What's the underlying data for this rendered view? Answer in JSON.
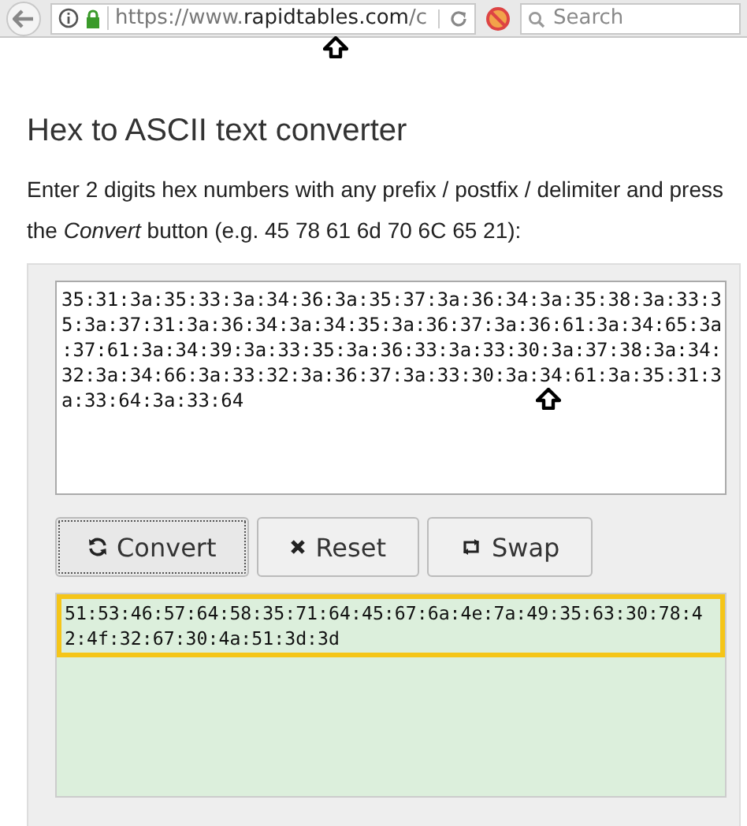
{
  "browser": {
    "url_prefix": "https://www.",
    "url_domain": "rapidtables.com",
    "url_suffix": "/c",
    "search": {
      "placeholder": "Search"
    }
  },
  "title": "Hex to ASCII text converter",
  "intro": "Enter 2 digits hex numbers with any prefix / postfix / delimiter and press the *Convert* button (e.g. 45 78 61 6d 70 6C 65 21):",
  "input": {
    "lines": [
      "35:31:3a:35:33:3a:34:36:3a:35:37:3a:36:34:3a:35:38:3a:33:3",
      "5:3a:37:31:3a:36:34:3a:34:35:3a:36:37:3a:36:61:3a:34:65:3a",
      ":37:61:3a:34:39:3a:33:35:3a:36:33:3a:33:30:3a:37:38:3a:34:",
      "32:3a:34:66:3a:33:32:3a:36:37:3a:33:30:3a:34:61:3a:35:31:3",
      "a:33:64:3a:33:64"
    ]
  },
  "buttons": [
    {
      "label": "Convert",
      "kind": "convert",
      "focused": true
    },
    {
      "label": "Reset",
      "kind": "reset",
      "focused": false
    },
    {
      "label": "Swap",
      "kind": "swap",
      "focused": false
    }
  ],
  "output": {
    "lines": [
      "51:53:46:57:64:58:35:71:64:45:67:6a:4e:7a:49:35:63:30:78:4",
      "2:4f:32:67:30:4a:51:3d:3d"
    ],
    "highlighted": true
  }
}
